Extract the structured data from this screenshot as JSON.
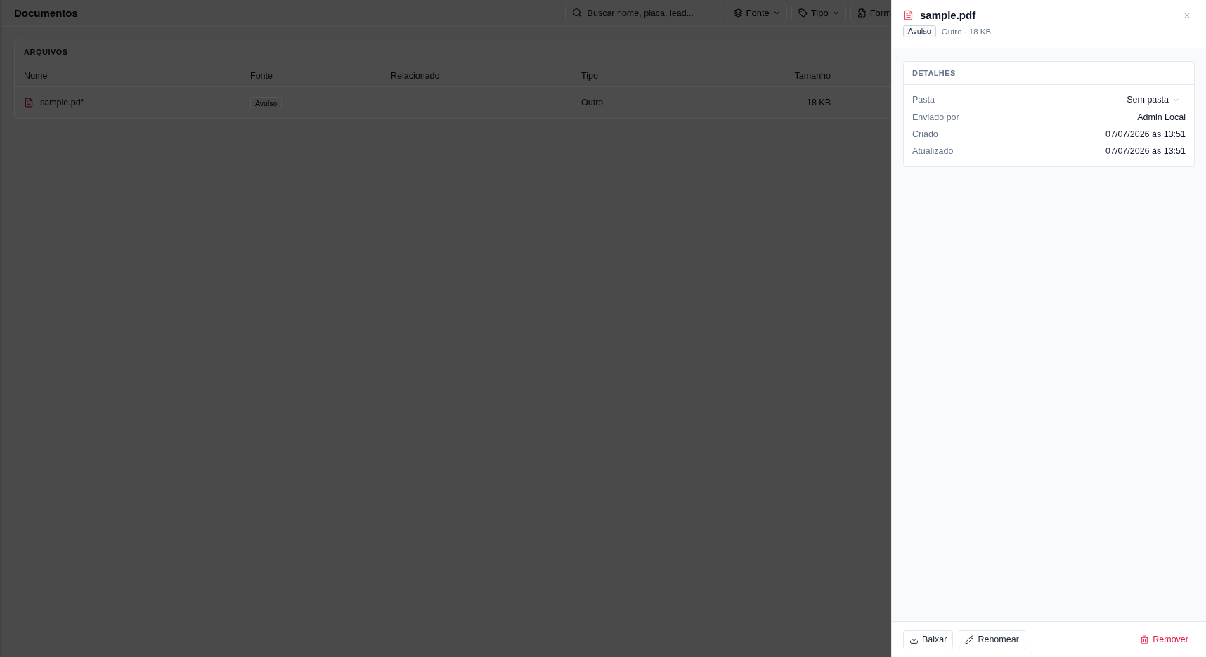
{
  "page": {
    "title": "Documentos",
    "search": {
      "placeholder": "Buscar nome, placa, lead..."
    },
    "filters": [
      {
        "label": "Fonte",
        "cut_off": false
      },
      {
        "label": "Tipo",
        "cut_off": false
      },
      {
        "label": "Form",
        "cut_off": true
      }
    ]
  },
  "files": {
    "title": "ARQUIVOS",
    "columns": [
      "Nome",
      "Fonte",
      "Relacionado",
      "Tipo",
      "Tamanho"
    ],
    "rows": [
      {
        "name": "sample.pdf",
        "source": "Avulso",
        "related": "—",
        "type": "Outro",
        "size": "18 KB"
      }
    ]
  },
  "panel": {
    "title": "sample.pdf",
    "badge": "Avulso",
    "meta": "Outro · 18 KB",
    "details": {
      "title": "DETALHES",
      "rows": [
        {
          "label": "Pasta",
          "value": "Sem pasta",
          "kind": "select"
        },
        {
          "label": "Enviado por",
          "value": "Admin Local",
          "kind": "text"
        },
        {
          "label": "Criado",
          "value": "07/07/2026 às 13:51",
          "kind": "text"
        },
        {
          "label": "Atualizado",
          "value": "07/07/2026 às 13:51",
          "kind": "text"
        }
      ]
    },
    "actions": [
      {
        "label": "Baixar",
        "kind": "download"
      },
      {
        "label": "Renomear",
        "kind": "edit"
      },
      {
        "label": "Remover",
        "kind": "delete"
      }
    ]
  }
}
